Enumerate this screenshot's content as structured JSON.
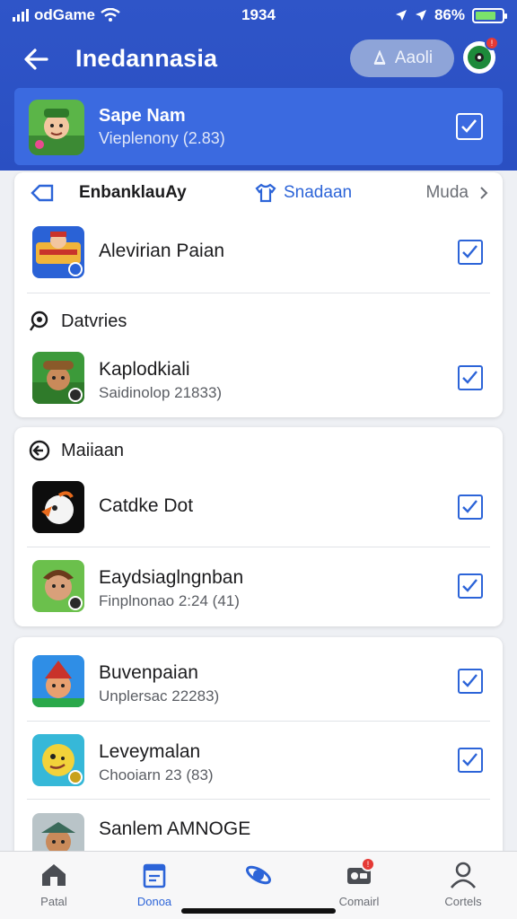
{
  "status": {
    "carrier": "odGame",
    "time": "1934",
    "battery": "86%"
  },
  "header": {
    "title": "Inedannasia",
    "action_label": "Aaoli"
  },
  "featured": {
    "name": "Sape Nam",
    "sub": "Vieplenony (2.83)"
  },
  "tabs": {
    "left": "EnbanklauAy",
    "middle": "Snadaan",
    "right": "Muda"
  },
  "sections": {
    "s1_title": "Datvries",
    "s2_title": "Maiiaan"
  },
  "items": [
    {
      "title": "Alevirian Paian",
      "sub": ""
    },
    {
      "title": "Kaplodkiali",
      "sub": "Saidinolop 21833)"
    },
    {
      "title": "Catdke Dot",
      "sub": ""
    },
    {
      "title": "Eaydsiaglngnban",
      "sub": "Finplnonao 2:24 (41)"
    },
    {
      "title": "Buvenpaian",
      "sub": "Unplersac 22283)"
    },
    {
      "title": "Leveymalan",
      "sub": "Chooiarn 23 (83)"
    },
    {
      "title": "Sanlem AMNOGE",
      "sub": ""
    }
  ],
  "bottom_tabs": [
    {
      "label": "Patal",
      "icon": "house-icon"
    },
    {
      "label": "Donoa",
      "icon": "document-icon"
    },
    {
      "label": "",
      "icon": "planet-icon"
    },
    {
      "label": "Comairl",
      "icon": "ticket-icon"
    },
    {
      "label": "Cortels",
      "icon": "person-icon"
    }
  ],
  "colors": {
    "header": "#2f55c8",
    "accent": "#2c64d8",
    "featured": "#3b6ae0"
  }
}
